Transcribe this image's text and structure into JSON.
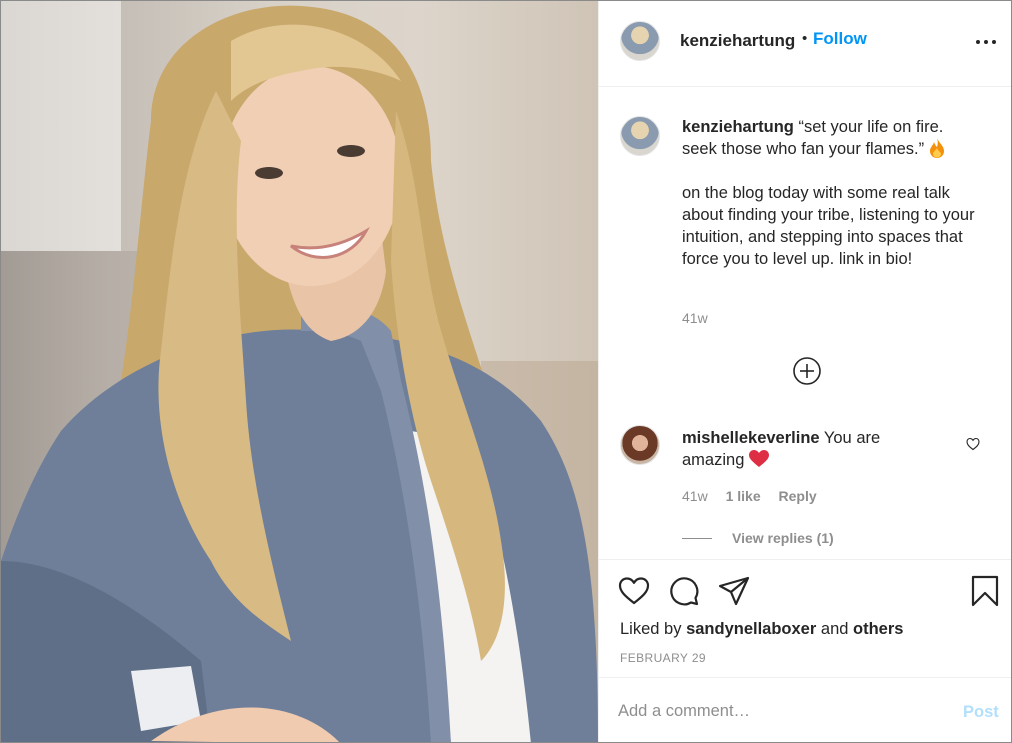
{
  "post": {
    "image_alt": "Woman with long blonde wavy hair in a ruffled chambray jacket smiling",
    "author": {
      "username": "kenziehartung",
      "separator": "•",
      "follow_label": "Follow"
    },
    "caption": {
      "username": "kenziehartung",
      "line1": "“set your life on fire. seek those who fan your flames.”",
      "line2": "on the blog today with some real talk about finding your tribe, listening to your intuition, and stepping into spaces that force you to level up. link in bio!",
      "time": "41w"
    },
    "comments": [
      {
        "username": "mishellekeverline",
        "text": "You are amazing",
        "time": "41w",
        "likes": "1 like",
        "reply_label": "Reply",
        "view_replies": "View replies (1)"
      }
    ],
    "likes": {
      "prefix": "Liked by",
      "user": "sandynellaboxer",
      "conjunction": "and",
      "others": "others"
    },
    "date": "FEBRUARY 29",
    "add_comment": {
      "placeholder": "Add a comment…",
      "post_label": "Post"
    },
    "icons": {
      "more": "more-options-icon",
      "load_more": "plus-circle-icon",
      "like": "heart-icon",
      "comment": "comment-icon",
      "share": "send-icon",
      "save": "bookmark-icon"
    },
    "colors": {
      "link": "#0095f6",
      "post_disabled": "#b2dffc",
      "secondary_text": "#8e8e8e"
    }
  }
}
